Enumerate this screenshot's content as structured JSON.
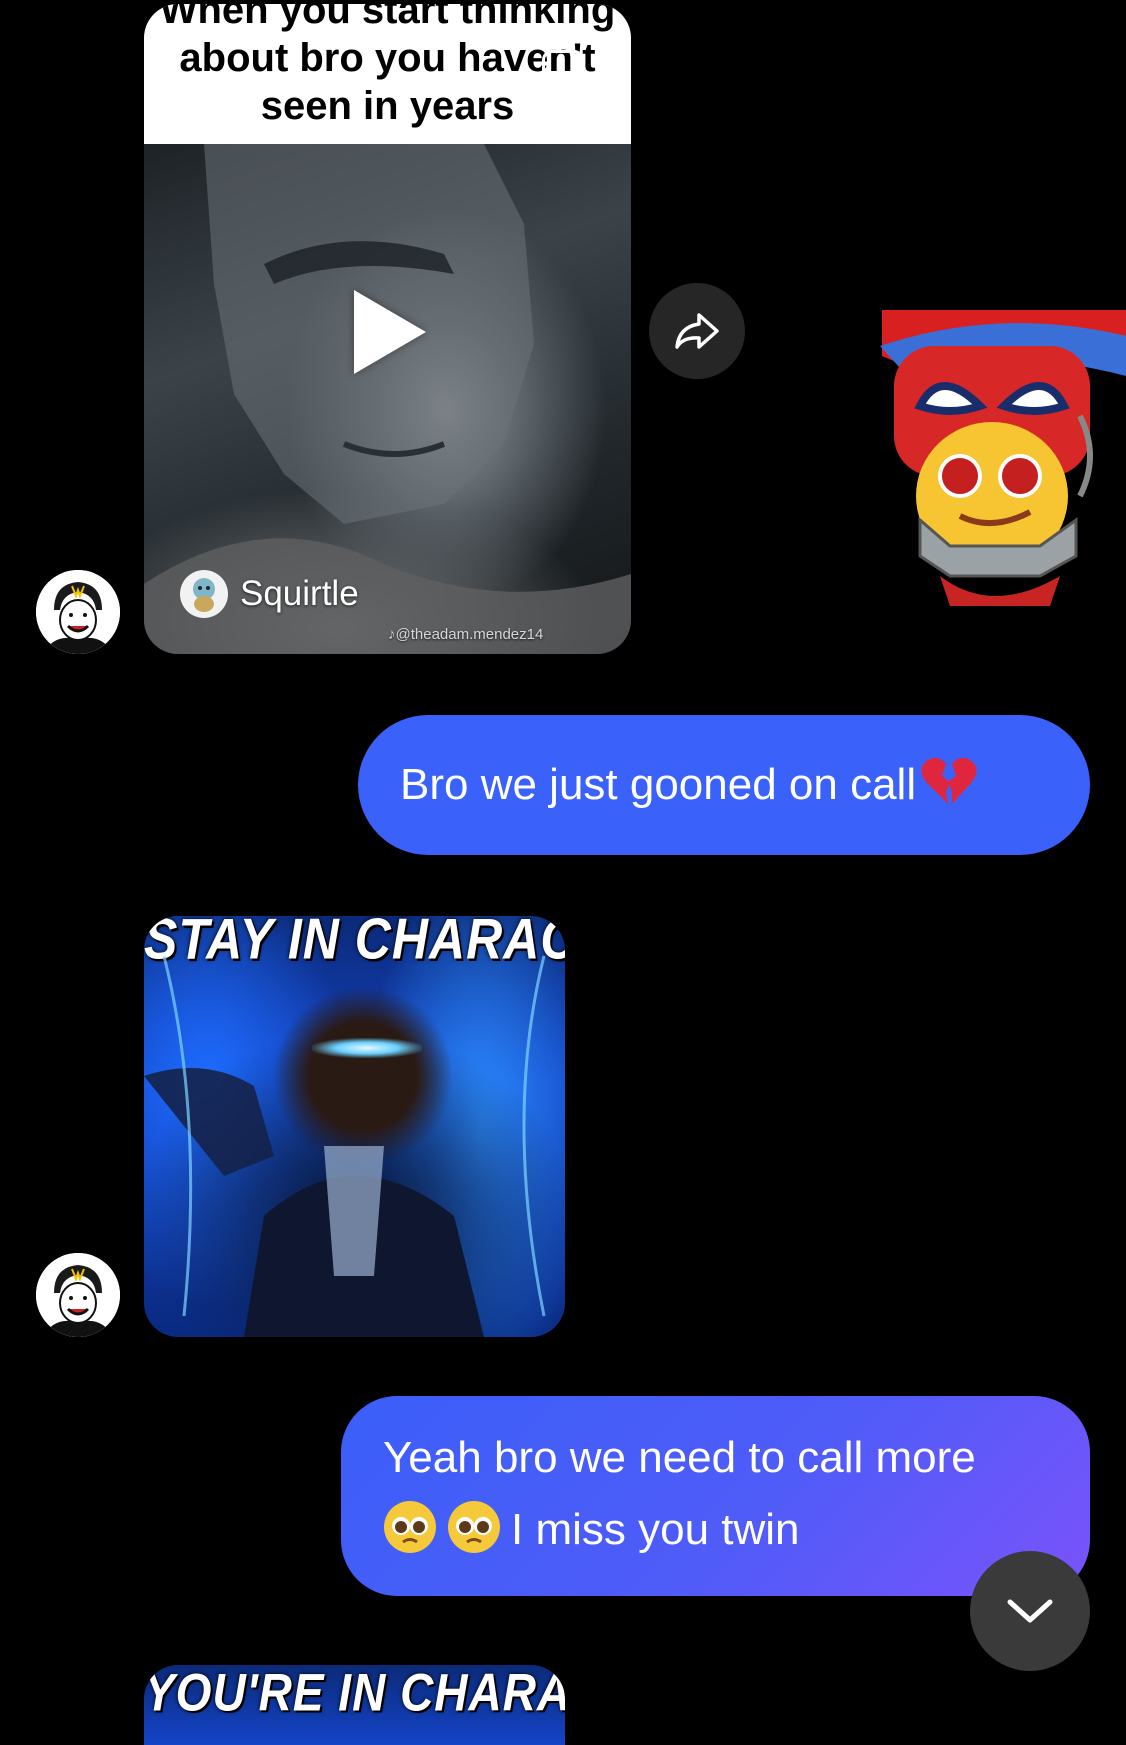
{
  "shared_reel": {
    "caption": "When you start thinking\nabout bro you haven't\nseen in years",
    "source_name": "Squirtle",
    "handle": "@theadam.mendez14"
  },
  "messages": [
    {
      "from": "me",
      "text": "Bro we just gooned on call",
      "emoji": "broken-heart"
    },
    {
      "from": "me",
      "line1": "Yeah bro we need to call more",
      "line2": "I miss you twin",
      "emoji": "pleading-face"
    }
  ],
  "gifs": [
    {
      "text": "STAY IN CHARACTER"
    },
    {
      "text": "YOU'RE IN CHARACTER"
    }
  ],
  "colors": {
    "background": "#000000",
    "bubble_blue": "#3a62fb",
    "bubble_purple": "#7a53fb",
    "share_button": "#262626",
    "scroll_button": "#3a3a3a"
  },
  "icons": {
    "share": "share-arrow-icon",
    "play": "play-icon",
    "scroll": "chevron-down-icon",
    "sticker": "spiderman-emoji-sticker"
  }
}
